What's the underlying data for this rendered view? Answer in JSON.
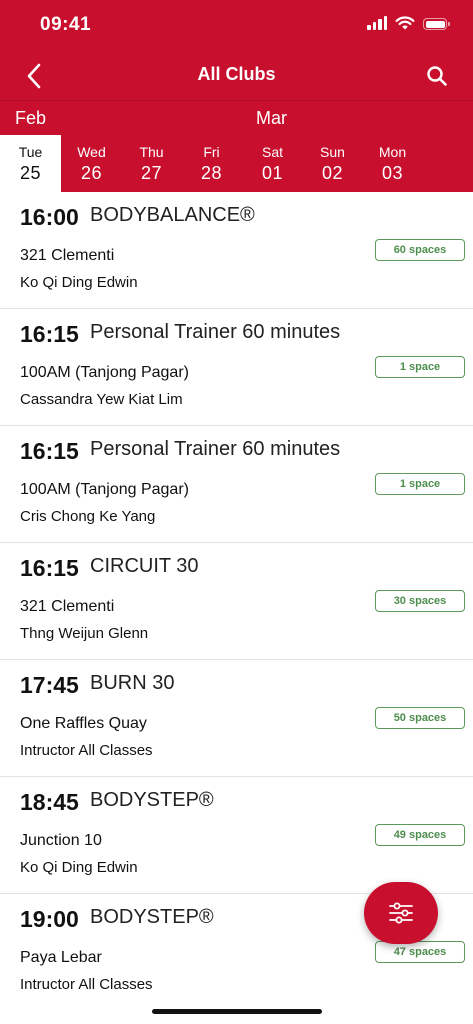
{
  "status_bar": {
    "time": "09:41"
  },
  "nav": {
    "title": "All Clubs",
    "back_icon": "chevron-left-icon",
    "search_icon": "search-icon"
  },
  "calendar": {
    "months": [
      "Feb",
      "Mar"
    ],
    "days": [
      {
        "dow": "Tue",
        "date": "25",
        "selected": true
      },
      {
        "dow": "Wed",
        "date": "26",
        "selected": false
      },
      {
        "dow": "Thu",
        "date": "27",
        "selected": false
      },
      {
        "dow": "Fri",
        "date": "28",
        "selected": false
      },
      {
        "dow": "Sat",
        "date": "01",
        "selected": false
      },
      {
        "dow": "Sun",
        "date": "02",
        "selected": false
      },
      {
        "dow": "Mon",
        "date": "03",
        "selected": false
      }
    ]
  },
  "classes": [
    {
      "time": "16:00",
      "name": "BODYBALANCE®",
      "club": "321 Clementi",
      "instructor": "Ko Qi Ding Edwin",
      "spaces": "60 spaces"
    },
    {
      "time": "16:15",
      "name": "Personal Trainer 60 minutes",
      "club": "100AM (Tanjong Pagar)",
      "instructor": "Cassandra Yew Kiat Lim",
      "spaces": "1 space"
    },
    {
      "time": "16:15",
      "name": "Personal Trainer 60 minutes",
      "club": "100AM (Tanjong Pagar)",
      "instructor": "Cris Chong Ke Yang",
      "spaces": "1 space"
    },
    {
      "time": "16:15",
      "name": "CIRCUIT 30",
      "club": "321 Clementi",
      "instructor": "Thng Weijun Glenn",
      "spaces": "30 spaces"
    },
    {
      "time": "17:45",
      "name": "BURN 30",
      "club": "One Raffles Quay",
      "instructor": "Intructor All Classes",
      "spaces": "50 spaces"
    },
    {
      "time": "18:45",
      "name": "BODYSTEP®",
      "club": "Junction 10",
      "instructor": "Ko Qi Ding Edwin",
      "spaces": "49 spaces"
    },
    {
      "time": "19:00",
      "name": "BODYSTEP®",
      "club": "Paya Lebar",
      "instructor": "Intructor All Classes",
      "spaces": "47 spaces"
    }
  ],
  "fab": {
    "icon": "filter-sliders-icon"
  },
  "colors": {
    "brand_red": "#c8102e",
    "spaces_green": "#4e8e4e"
  }
}
